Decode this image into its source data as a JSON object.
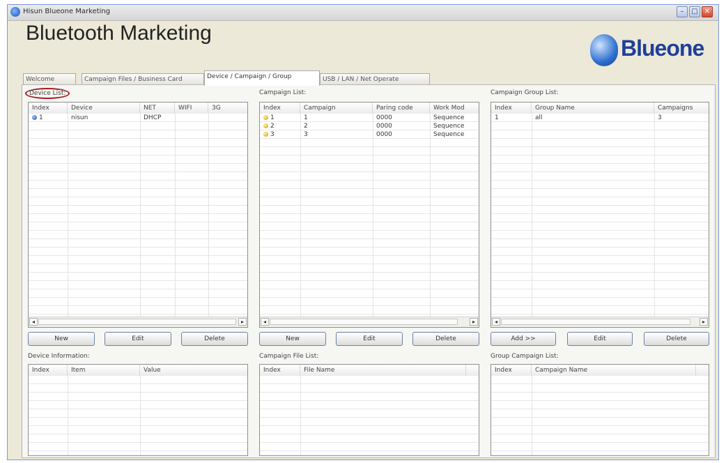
{
  "window": {
    "title": "Hisun Blueone Marketing",
    "minimize": "–",
    "maximize": "□",
    "close": "✕"
  },
  "header": {
    "title": "Bluetooth Marketing",
    "logo_text": "Blueone"
  },
  "tabs": [
    {
      "label": "Welcome"
    },
    {
      "label": "Campaign Files / Business Card"
    },
    {
      "label": "Device / Campaign / Group"
    },
    {
      "label": "USB / LAN / Net Operate"
    }
  ],
  "device_list": {
    "label": "Device List:",
    "columns": [
      "Index",
      "Device",
      "NET",
      "WIFI",
      "3G"
    ],
    "rows": [
      {
        "index": "1",
        "device": "nisun",
        "net": "DHCP",
        "wifi": "",
        "g3": ""
      }
    ],
    "buttons": {
      "new": "New",
      "edit": "Edit",
      "delete": "Delete"
    }
  },
  "device_info": {
    "label": "Device Information:",
    "columns": [
      "Index",
      "Item",
      "Value"
    ]
  },
  "campaign_list": {
    "label": "Campaign List:",
    "columns": [
      "Index",
      "Campaign",
      "Paring code",
      "Work Mod"
    ],
    "rows": [
      {
        "index": "1",
        "campaign": "1",
        "code": "0000",
        "mode": "Sequence"
      },
      {
        "index": "2",
        "campaign": "2",
        "code": "0000",
        "mode": "Sequence"
      },
      {
        "index": "3",
        "campaign": "3",
        "code": "0000",
        "mode": "Sequence"
      }
    ],
    "buttons": {
      "new": "New",
      "edit": "Edit",
      "delete": "Delete"
    }
  },
  "campaign_file_list": {
    "label": "Campaign File List:",
    "columns": [
      "Index",
      "File Name"
    ]
  },
  "group_list": {
    "label": "Campaign Group List:",
    "columns": [
      "Index",
      "Group Name",
      "Campaigns"
    ],
    "rows": [
      {
        "index": "1",
        "name": "all",
        "campaigns": "3"
      }
    ],
    "buttons": {
      "add": "Add >>",
      "edit": "Edit",
      "delete": "Delete"
    }
  },
  "group_campaign_list": {
    "label": "Group Campaign List:",
    "columns": [
      "Index",
      "Campaign Name"
    ]
  },
  "scroll": {
    "left": "◂",
    "right": "▸"
  }
}
